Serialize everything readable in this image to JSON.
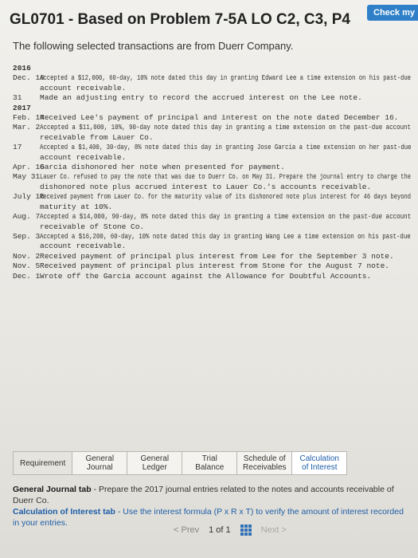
{
  "header": {
    "check_label": "Check my",
    "title": "GL0701 - Based on Problem 7-5A LO C2, C3, P4",
    "intro": "The following selected transactions are from Duerr Company."
  },
  "transactions": [
    {
      "date": "2016",
      "text": "",
      "year": true
    },
    {
      "date": "Dec. 16",
      "text": "Accepted a $12,000, 60-day, 10% note dated this day in granting Edward Lee a time extension on his past-due"
    },
    {
      "date": "",
      "text": "account receivable."
    },
    {
      "date": "31",
      "text": "Made an adjusting entry to record the accrued interest on the Lee note."
    },
    {
      "date": "2017",
      "text": "",
      "year": true
    },
    {
      "date": "Feb. 14",
      "text": "Received Lee's payment of principal and interest on the note dated December 16."
    },
    {
      "date": "Mar. 2",
      "text": "Accepted a $11,000, 10%, 90-day note dated this day in granting a time extension on the past-due account"
    },
    {
      "date": "",
      "text": "receivable from Lauer Co."
    },
    {
      "date": "17",
      "text": "Accepted a $1,400, 30-day, 8% note dated this day in granting Jose Garcia a time extension on her past-due"
    },
    {
      "date": "",
      "text": "account receivable."
    },
    {
      "date": "Apr. 16",
      "text": "Garcia dishonored her note when presented for payment."
    },
    {
      "date": "May 31",
      "text": "Lauer Co. refused to pay the note that was due to Duerr Co. on May 31. Prepare the journal entry to charge the"
    },
    {
      "date": "",
      "text": "dishonored note plus accrued interest to Lauer Co.'s accounts receivable."
    },
    {
      "date": "July 16",
      "text": "Received payment from Lauer Co. for the maturity value of its dishonored note plus interest for 46 days beyond"
    },
    {
      "date": "",
      "text": "maturity at 10%."
    },
    {
      "date": "Aug. 7",
      "text": "Accepted a $14,000, 90-day, 8% note dated this day in granting a time extension on the past-due account"
    },
    {
      "date": "",
      "text": "receivable of Stone Co."
    },
    {
      "date": "Sep. 3",
      "text": "Accepted a $16,200, 60-day, 10% note dated this day in granting Wang Lee a time extension on his past-due"
    },
    {
      "date": "",
      "text": "account receivable."
    },
    {
      "date": "Nov. 2",
      "text": "Received payment of principal plus interest from Lee for the September 3 note."
    },
    {
      "date": "Nov. 5",
      "text": "Received payment of principal plus interest from Stone for the August 7 note."
    },
    {
      "date": "Dec. 1",
      "text": "Wrote off the Garcia account against the Allowance for Doubtful Accounts."
    }
  ],
  "tabs": [
    {
      "label": "Requirement",
      "name": "tab-requirement"
    },
    {
      "label": "General Journal",
      "name": "tab-general-journal"
    },
    {
      "label": "General Ledger",
      "name": "tab-general-ledger"
    },
    {
      "label": "Trial Balance",
      "name": "tab-trial-balance"
    },
    {
      "label": "Schedule of Receivables",
      "name": "tab-schedule-of-receivables"
    },
    {
      "label": "Calculation of Interest",
      "name": "tab-calculation-of-interest"
    }
  ],
  "instructions": {
    "journal_bold": "General Journal tab",
    "journal_text": " - Prepare the 2017 journal entries related to the notes and accounts receivable of Duerr Co.",
    "interest_bold": "Calculation of Interest tab",
    "interest_text": " - Use the interest formula (P x R x T) to verify the amount of interest recorded in your entries."
  },
  "pager": {
    "prev": "< Prev",
    "page": "1",
    "of": "of",
    "total": "1",
    "next": "Next >"
  },
  "colors": {
    "accent": "#2f80c8",
    "link": "#1d5ea8"
  }
}
